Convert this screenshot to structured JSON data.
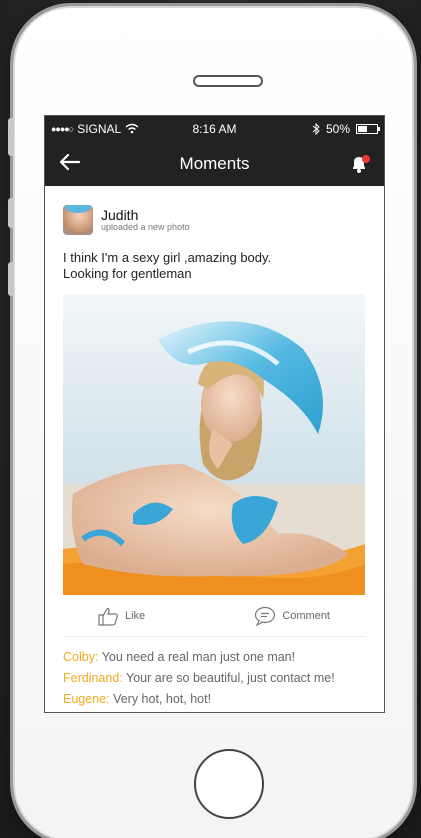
{
  "status_bar": {
    "carrier": "SIGNAL",
    "time": "8:16 AM",
    "battery": "50%"
  },
  "nav": {
    "title": "Moments",
    "back_icon": "arrow-left-icon",
    "notification_icon": "bell-icon"
  },
  "post": {
    "author_name": "Judith",
    "author_action": "uploaded a new photo",
    "text_line1": "I think I'm a sexy girl ,amazing body.",
    "text_line2": "Looking for gentleman"
  },
  "actions": {
    "like_label": "Like",
    "comment_label": "Comment"
  },
  "comments": [
    {
      "name": "Colby:",
      "text": "You need a real man just one man!"
    },
    {
      "name": "Ferdinand:",
      "text": "Your are so beautiful, just contact me!"
    },
    {
      "name": "Eugene:",
      "text": "Very hot, hot, hot!"
    }
  ],
  "colors": {
    "header_bg": "#222222",
    "commenter_name": "#f2a91e",
    "notification_dot": "#e53935",
    "hat": "#4fb6e0",
    "towel": "#f5a032"
  }
}
